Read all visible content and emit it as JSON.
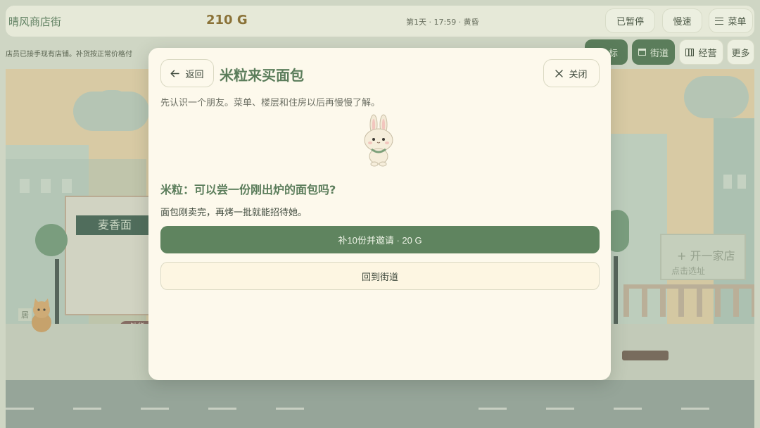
{
  "topbar": {
    "title": "晴风商店街",
    "gold": "210 G",
    "clock": "第1天 · 17:59 · 黄昏",
    "pause_label": "已暂停",
    "speed_label": "慢速",
    "menu_label": "菜单"
  },
  "notice": "店员已接手现有店铺。补货按正常价格付",
  "subbar": {
    "goal_label": "标",
    "street_label": "街道",
    "manage_label": "经营",
    "more_label": "更多"
  },
  "scene": {
    "shop_sign": "麦香面",
    "shop_tag": "缺货 2",
    "open_shop_label": "+ 开一家店",
    "open_shop_hint": "点击选址",
    "resident_tag": "居"
  },
  "modal": {
    "back_label": "返回",
    "title": "米粒来买面包",
    "close_label": "关闭",
    "intro": "先认识一个朋友。菜单、楼层和住房以后再慢慢了解。",
    "question": "米粒：可以尝一份刚出炉的面包吗?",
    "description": "面包刚卖完，再烤一批就能招待她。",
    "primary_label": "补10份并邀请 · 20 G",
    "secondary_label": "回到街道"
  },
  "colors": {
    "accent_green": "#5f845f",
    "title_green": "#5b7d5b",
    "modal_bg": "#fdf9ec",
    "gold": "#8a7238"
  },
  "icons": {
    "back": "arrow-left-icon",
    "close": "close-icon",
    "menu": "hamburger-icon",
    "street": "storefront-icon",
    "manage": "map-icon"
  }
}
